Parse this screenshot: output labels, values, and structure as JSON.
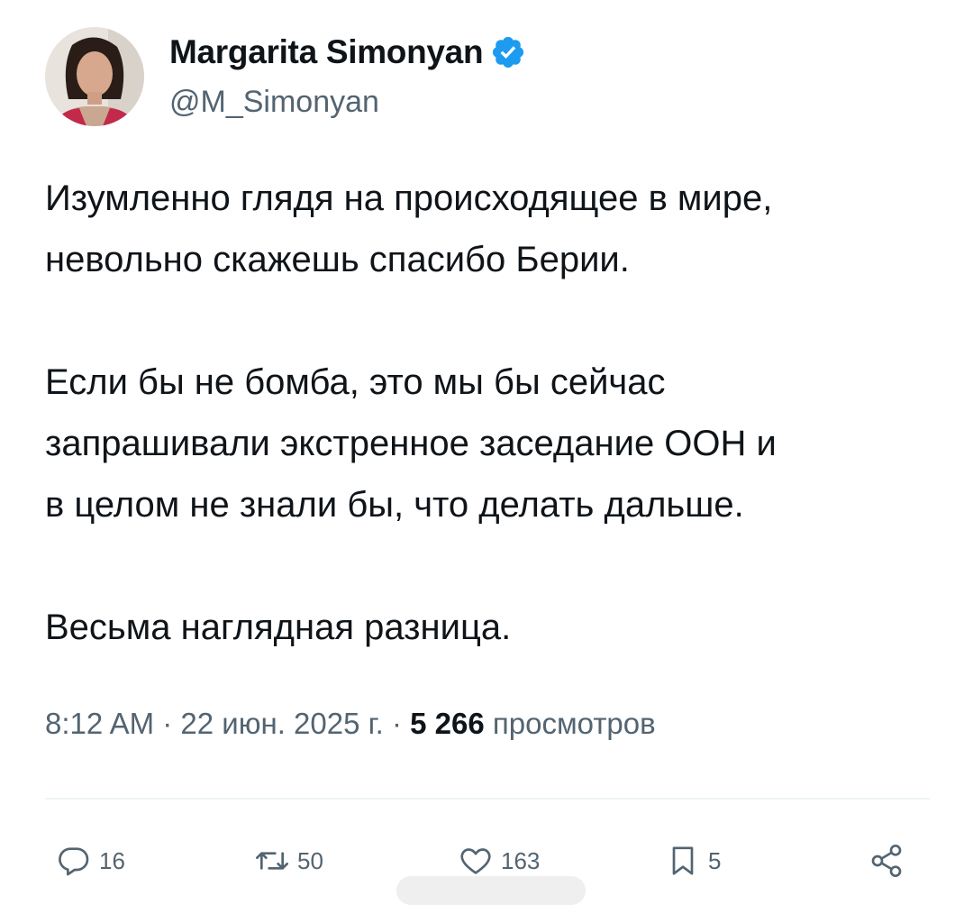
{
  "author": {
    "display_name": "Margarita Simonyan",
    "handle": "@M_Simonyan",
    "verified": true,
    "verified_color": "#1d9bf0"
  },
  "tweet": {
    "paragraphs": [
      "Изумленно глядя на происходящее в мире,",
      "невольно скажешь спасибо Берии.",
      "Если бы не бомба, это мы бы сейчас",
      "запрашивали экстренное заседание ООН и",
      "в целом не знали бы, что делать дальше.",
      "Весьма наглядная разница."
    ],
    "time": "8:12 AM",
    "separator": "·",
    "date": "22 июн. 2025 г.",
    "views_count": "5 266",
    "views_label": "просмотров"
  },
  "actions": {
    "replies": {
      "icon": "reply-icon",
      "count": "16"
    },
    "retweets": {
      "icon": "retweet-icon",
      "count": "50"
    },
    "likes": {
      "icon": "like-icon",
      "count": "163"
    },
    "bookmarks": {
      "icon": "bookmark-icon",
      "count": "5"
    },
    "share": {
      "icon": "share-icon"
    }
  },
  "colors": {
    "text_primary": "#0f1419",
    "text_secondary": "#536471",
    "divider": "#eff3f4",
    "accent": "#1d9bf0"
  }
}
